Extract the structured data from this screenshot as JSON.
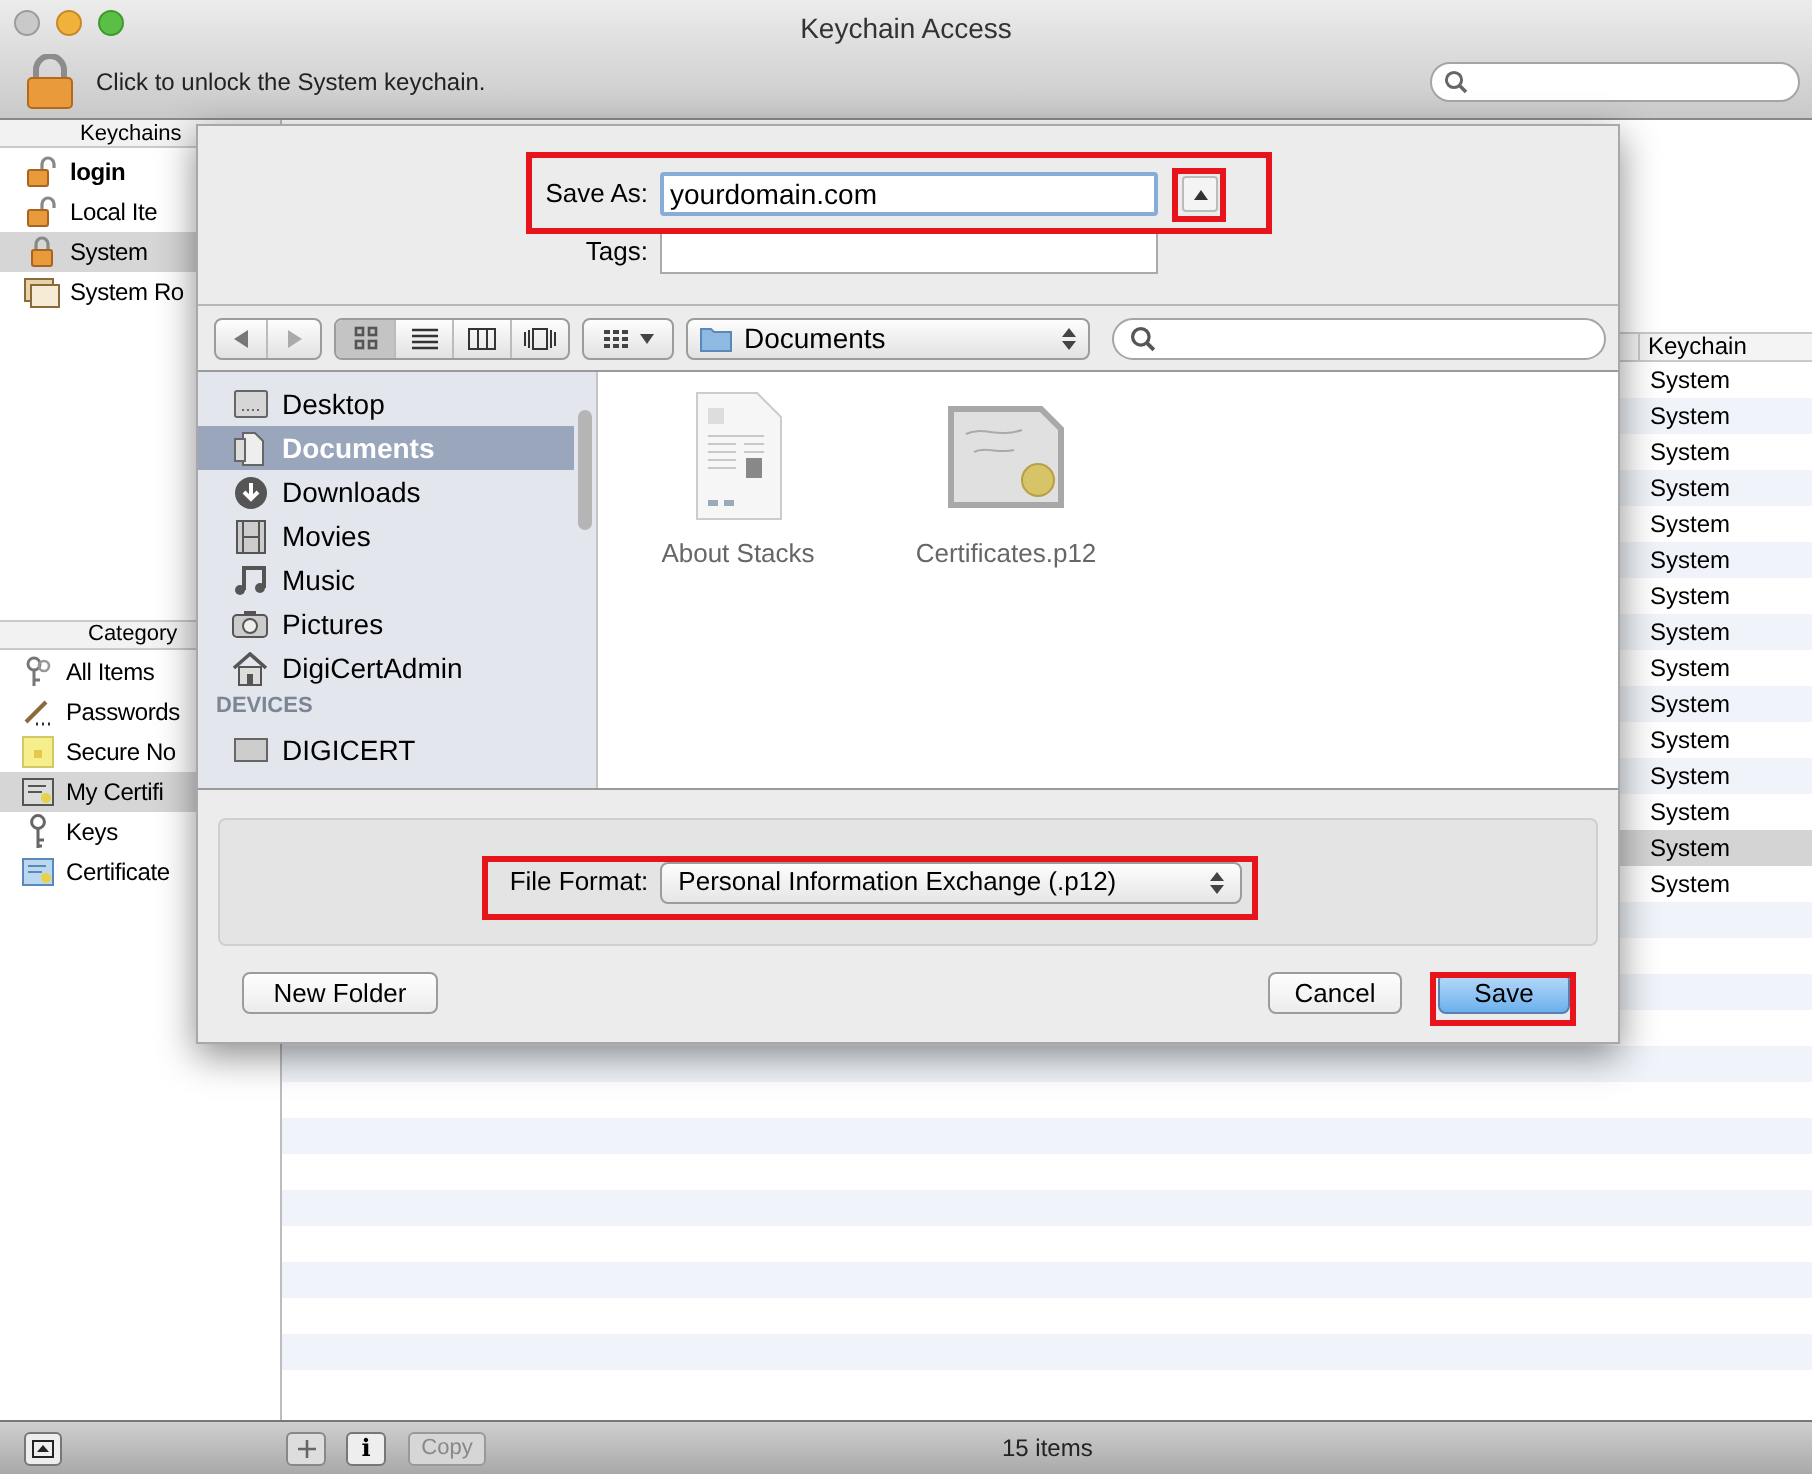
{
  "window": {
    "title": "Keychain Access"
  },
  "toolbar": {
    "lock_message": "Click to unlock the System keychain."
  },
  "sidebar": {
    "keychains_header": "Keychains",
    "keychains": [
      {
        "label": "login",
        "default": true,
        "selected": false
      },
      {
        "label": "Local Ite",
        "default": false,
        "selected": false
      },
      {
        "label": "System",
        "default": false,
        "selected": true
      },
      {
        "label": "System Ro",
        "default": false,
        "selected": false
      }
    ],
    "category_header": "Category",
    "categories": [
      {
        "label": "All Items",
        "selected": false
      },
      {
        "label": "Passwords",
        "selected": false
      },
      {
        "label": "Secure No",
        "selected": false
      },
      {
        "label": "My Certifi",
        "selected": true
      },
      {
        "label": "Keys",
        "selected": false
      },
      {
        "label": "Certificate",
        "selected": false
      }
    ]
  },
  "table": {
    "columns": [
      "Keychain"
    ],
    "rows": [
      {
        "keychain": "System",
        "selected": false
      },
      {
        "keychain": "System",
        "selected": false
      },
      {
        "keychain": "System",
        "selected": false
      },
      {
        "keychain": "System",
        "selected": false
      },
      {
        "keychain": "System",
        "selected": false
      },
      {
        "keychain": "System",
        "selected": false
      },
      {
        "keychain": "System",
        "selected": false
      },
      {
        "keychain": "System",
        "selected": false
      },
      {
        "keychain": "System",
        "selected": false
      },
      {
        "keychain": "System",
        "selected": false
      },
      {
        "keychain": "System",
        "selected": false
      },
      {
        "keychain": "System",
        "selected": false
      },
      {
        "keychain": "System",
        "selected": false
      },
      {
        "keychain": "System",
        "selected": true
      },
      {
        "keychain": "System",
        "selected": false
      }
    ]
  },
  "save_sheet": {
    "save_as": {
      "label": "Save As:",
      "value": "yourdomain.com"
    },
    "tags": {
      "label": "Tags:"
    },
    "views": [
      {
        "selected": true
      },
      {
        "selected": false
      },
      {
        "selected": false
      },
      {
        "selected": false
      }
    ],
    "location": "Documents",
    "places": [
      {
        "label": "Desktop",
        "selected": false
      },
      {
        "label": "Documents",
        "selected": true
      },
      {
        "label": "Downloads",
        "selected": false
      },
      {
        "label": "Movies",
        "selected": false
      },
      {
        "label": "Music",
        "selected": false
      },
      {
        "label": "Pictures",
        "selected": false
      },
      {
        "label": "DigiCertAdmin",
        "selected": false
      }
    ],
    "devices_header": "DEVICES",
    "devices": [
      "DIGICERT"
    ],
    "files": [
      {
        "name": "About Stacks",
        "kind": "document"
      },
      {
        "name": "Certificates.p12",
        "kind": "certificate"
      }
    ],
    "file_format": {
      "label": "File Format:",
      "value": "Personal Information Exchange (.p12)"
    },
    "buttons": [
      {
        "label": "New Folder",
        "kind": "secondary"
      },
      {
        "label": "Cancel",
        "kind": "secondary"
      },
      {
        "label": "Save",
        "kind": "default"
      }
    ]
  },
  "status_bar": {
    "info_button": "i",
    "copy_button": {
      "label": "Copy",
      "disabled": true
    },
    "count": "15 items"
  }
}
